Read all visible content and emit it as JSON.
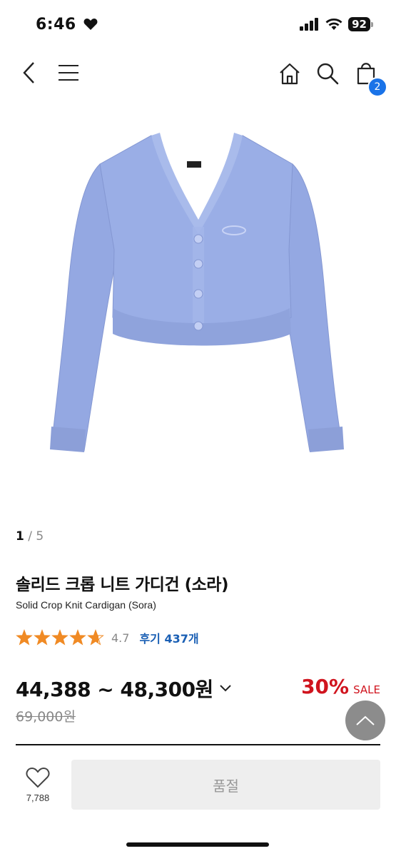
{
  "status_bar": {
    "time": "6:46",
    "battery": "92"
  },
  "header": {
    "cart_count": "2"
  },
  "gallery": {
    "current": "1",
    "total": "5",
    "separator": "/"
  },
  "product": {
    "name_ko": "솔리드 크롭 니트 가디건 (소라)",
    "name_en": "Solid Crop Knit Cardigan (Sora)",
    "rating": "4.7",
    "rating_value": 4.7,
    "stars_total": 5,
    "review_label": "후기 437개",
    "price_range": "44,388 ~ 48,300원",
    "discount_percent": "30%",
    "sale_label": "SALE",
    "original_price": "69,000원"
  },
  "bottom_bar": {
    "wish_count": "7,788",
    "soldout_label": "품절"
  },
  "colors": {
    "accent_blue": "#1a73e8",
    "discount_red": "#d0141e",
    "star_orange": "#f08a24",
    "cardigan": "#9aaee6"
  },
  "icons": [
    "heart-icon",
    "signal-icon",
    "wifi-icon",
    "battery-icon",
    "back-icon",
    "menu-icon",
    "home-icon",
    "search-icon",
    "cart-icon",
    "star-icon",
    "chevron-down-icon",
    "arrow-up-icon"
  ]
}
